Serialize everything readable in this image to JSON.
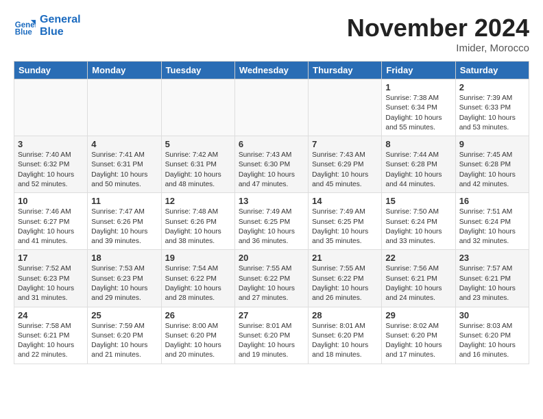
{
  "logo": {
    "line1": "General",
    "line2": "Blue"
  },
  "title": "November 2024",
  "location": "Imider, Morocco",
  "weekdays": [
    "Sunday",
    "Monday",
    "Tuesday",
    "Wednesday",
    "Thursday",
    "Friday",
    "Saturday"
  ],
  "weeks": [
    [
      {
        "day": "",
        "info": ""
      },
      {
        "day": "",
        "info": ""
      },
      {
        "day": "",
        "info": ""
      },
      {
        "day": "",
        "info": ""
      },
      {
        "day": "",
        "info": ""
      },
      {
        "day": "1",
        "info": "Sunrise: 7:38 AM\nSunset: 6:34 PM\nDaylight: 10 hours\nand 55 minutes."
      },
      {
        "day": "2",
        "info": "Sunrise: 7:39 AM\nSunset: 6:33 PM\nDaylight: 10 hours\nand 53 minutes."
      }
    ],
    [
      {
        "day": "3",
        "info": "Sunrise: 7:40 AM\nSunset: 6:32 PM\nDaylight: 10 hours\nand 52 minutes."
      },
      {
        "day": "4",
        "info": "Sunrise: 7:41 AM\nSunset: 6:31 PM\nDaylight: 10 hours\nand 50 minutes."
      },
      {
        "day": "5",
        "info": "Sunrise: 7:42 AM\nSunset: 6:31 PM\nDaylight: 10 hours\nand 48 minutes."
      },
      {
        "day": "6",
        "info": "Sunrise: 7:43 AM\nSunset: 6:30 PM\nDaylight: 10 hours\nand 47 minutes."
      },
      {
        "day": "7",
        "info": "Sunrise: 7:43 AM\nSunset: 6:29 PM\nDaylight: 10 hours\nand 45 minutes."
      },
      {
        "day": "8",
        "info": "Sunrise: 7:44 AM\nSunset: 6:28 PM\nDaylight: 10 hours\nand 44 minutes."
      },
      {
        "day": "9",
        "info": "Sunrise: 7:45 AM\nSunset: 6:28 PM\nDaylight: 10 hours\nand 42 minutes."
      }
    ],
    [
      {
        "day": "10",
        "info": "Sunrise: 7:46 AM\nSunset: 6:27 PM\nDaylight: 10 hours\nand 41 minutes."
      },
      {
        "day": "11",
        "info": "Sunrise: 7:47 AM\nSunset: 6:26 PM\nDaylight: 10 hours\nand 39 minutes."
      },
      {
        "day": "12",
        "info": "Sunrise: 7:48 AM\nSunset: 6:26 PM\nDaylight: 10 hours\nand 38 minutes."
      },
      {
        "day": "13",
        "info": "Sunrise: 7:49 AM\nSunset: 6:25 PM\nDaylight: 10 hours\nand 36 minutes."
      },
      {
        "day": "14",
        "info": "Sunrise: 7:49 AM\nSunset: 6:25 PM\nDaylight: 10 hours\nand 35 minutes."
      },
      {
        "day": "15",
        "info": "Sunrise: 7:50 AM\nSunset: 6:24 PM\nDaylight: 10 hours\nand 33 minutes."
      },
      {
        "day": "16",
        "info": "Sunrise: 7:51 AM\nSunset: 6:24 PM\nDaylight: 10 hours\nand 32 minutes."
      }
    ],
    [
      {
        "day": "17",
        "info": "Sunrise: 7:52 AM\nSunset: 6:23 PM\nDaylight: 10 hours\nand 31 minutes."
      },
      {
        "day": "18",
        "info": "Sunrise: 7:53 AM\nSunset: 6:23 PM\nDaylight: 10 hours\nand 29 minutes."
      },
      {
        "day": "19",
        "info": "Sunrise: 7:54 AM\nSunset: 6:22 PM\nDaylight: 10 hours\nand 28 minutes."
      },
      {
        "day": "20",
        "info": "Sunrise: 7:55 AM\nSunset: 6:22 PM\nDaylight: 10 hours\nand 27 minutes."
      },
      {
        "day": "21",
        "info": "Sunrise: 7:55 AM\nSunset: 6:22 PM\nDaylight: 10 hours\nand 26 minutes."
      },
      {
        "day": "22",
        "info": "Sunrise: 7:56 AM\nSunset: 6:21 PM\nDaylight: 10 hours\nand 24 minutes."
      },
      {
        "day": "23",
        "info": "Sunrise: 7:57 AM\nSunset: 6:21 PM\nDaylight: 10 hours\nand 23 minutes."
      }
    ],
    [
      {
        "day": "24",
        "info": "Sunrise: 7:58 AM\nSunset: 6:21 PM\nDaylight: 10 hours\nand 22 minutes."
      },
      {
        "day": "25",
        "info": "Sunrise: 7:59 AM\nSunset: 6:20 PM\nDaylight: 10 hours\nand 21 minutes."
      },
      {
        "day": "26",
        "info": "Sunrise: 8:00 AM\nSunset: 6:20 PM\nDaylight: 10 hours\nand 20 minutes."
      },
      {
        "day": "27",
        "info": "Sunrise: 8:01 AM\nSunset: 6:20 PM\nDaylight: 10 hours\nand 19 minutes."
      },
      {
        "day": "28",
        "info": "Sunrise: 8:01 AM\nSunset: 6:20 PM\nDaylight: 10 hours\nand 18 minutes."
      },
      {
        "day": "29",
        "info": "Sunrise: 8:02 AM\nSunset: 6:20 PM\nDaylight: 10 hours\nand 17 minutes."
      },
      {
        "day": "30",
        "info": "Sunrise: 8:03 AM\nSunset: 6:20 PM\nDaylight: 10 hours\nand 16 minutes."
      }
    ]
  ]
}
